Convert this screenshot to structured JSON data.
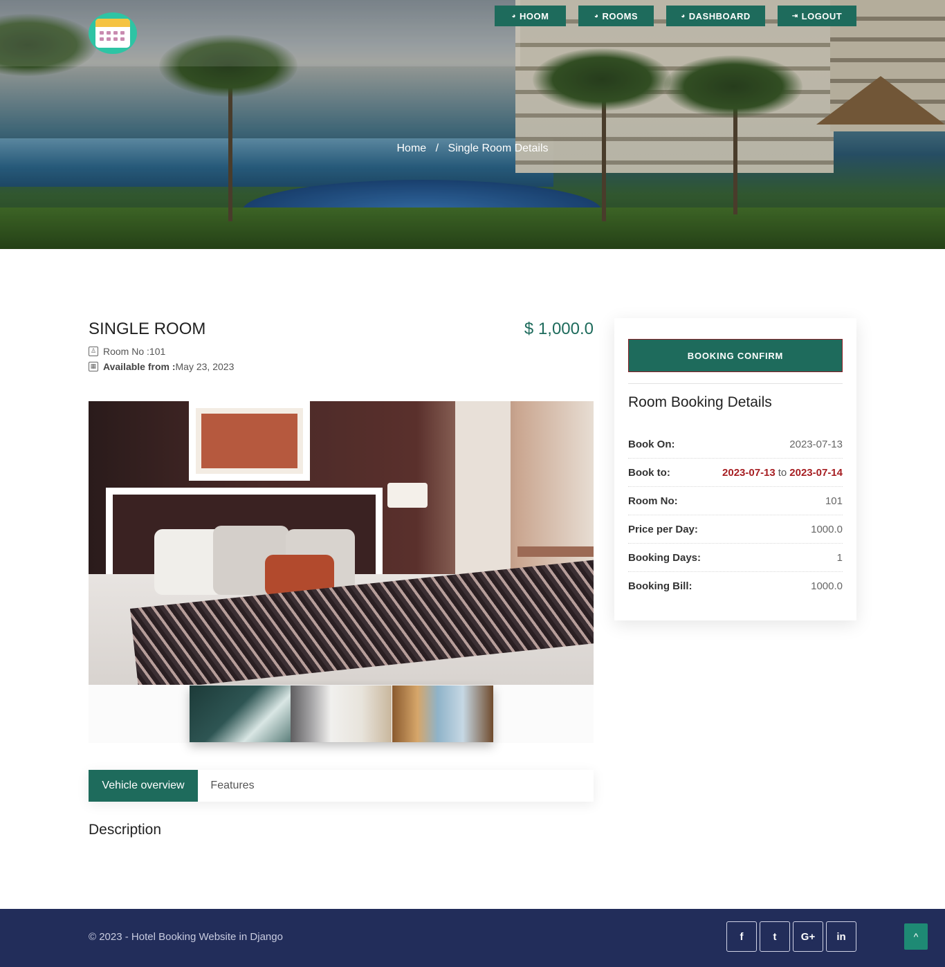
{
  "nav": {
    "items": [
      {
        "label": "HOOM",
        "icon": "dashboard-icon"
      },
      {
        "label": "ROOMS",
        "icon": "dashboard-icon"
      },
      {
        "label": "DASHBOARD",
        "icon": "dashboard-icon"
      },
      {
        "label": "LOGOUT",
        "icon": "logout-icon"
      }
    ]
  },
  "breadcrumb": {
    "home": "Home",
    "separator": "/",
    "current": "Single Room Details"
  },
  "room": {
    "title": "SINGLE ROOM",
    "price": "$ 1,000.0",
    "room_no_label": "Room No :",
    "room_no": "101",
    "available_label": "Available from :",
    "available_date": "May 23, 2023"
  },
  "tabs": {
    "active": "Vehicle overview",
    "other": "Features"
  },
  "description_heading": "Description",
  "booking": {
    "confirm_label": "BOOKING CONFIRM",
    "heading": "Room Booking Details",
    "book_on_label": "Book On:",
    "book_on": "2023-07-13",
    "book_to_label": "Book to:",
    "book_to_from": "2023-07-13",
    "book_to_word": "to",
    "book_to_until": "2023-07-14",
    "room_no_label": "Room No:",
    "room_no": "101",
    "price_label": "Price per Day:",
    "price": "1000.0",
    "days_label": "Booking Days:",
    "days": "1",
    "bill_label": "Booking Bill:",
    "bill": "1000.0"
  },
  "footer": {
    "copyright": "© 2023 - Hotel Booking Website in Django",
    "social": [
      {
        "icon": "facebook-icon",
        "glyph": "f"
      },
      {
        "icon": "twitter-icon",
        "glyph": "t"
      },
      {
        "icon": "google-plus-icon",
        "glyph": "G+"
      },
      {
        "icon": "linkedin-icon",
        "glyph": "in"
      }
    ],
    "to_top_glyph": "^"
  },
  "colors": {
    "accent": "#1e6b5c",
    "footer": "#222d5a",
    "alert": "#a61e22"
  }
}
